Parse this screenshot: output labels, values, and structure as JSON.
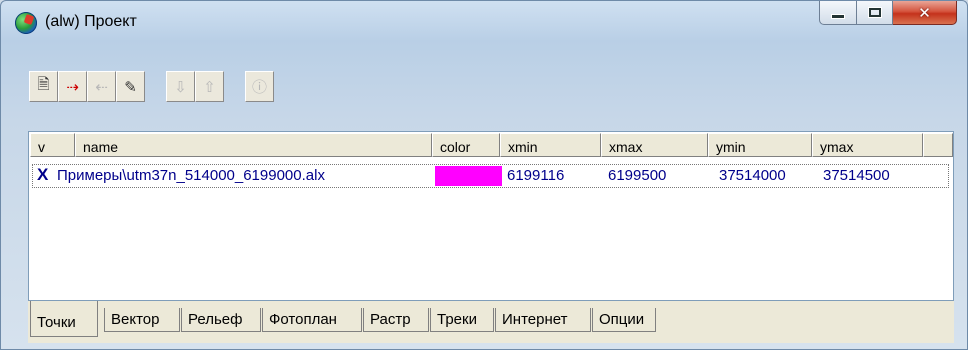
{
  "window": {
    "title": "(alw) Проект"
  },
  "title_buttons": {
    "minimize": "minimize-icon",
    "maximize": "maximize-icon",
    "close": "close-icon"
  },
  "toolbar": {
    "buttons": [
      {
        "icon": "new-document-icon",
        "glyph": "🗎",
        "enabled": true
      },
      {
        "icon": "add-layer-icon",
        "glyph": "⇢",
        "enabled": true
      },
      {
        "icon": "remove-layer-icon",
        "glyph": "⇠",
        "enabled": false
      },
      {
        "icon": "edit-brush-icon",
        "glyph": "🖌",
        "enabled": true
      },
      {
        "icon": "move-down-icon",
        "glyph": "⇩",
        "enabled": false
      },
      {
        "icon": "move-up-icon",
        "glyph": "⇧",
        "enabled": false
      },
      {
        "icon": "info-icon",
        "glyph": "ⓘ",
        "enabled": false
      }
    ]
  },
  "table": {
    "columns": [
      "v",
      "name",
      "color",
      "xmin",
      "xmax",
      "ymin",
      "ymax"
    ],
    "rows": [
      {
        "v": "X",
        "name": "Примеры\\utm37n_514000_6199000.alx",
        "color": "#ff00ff",
        "xmin": "6199116",
        "xmax": "6199500",
        "ymin": "37514000",
        "ymax": "37514500"
      }
    ]
  },
  "tabs": [
    "Точки",
    "Вектор",
    "Рельеф",
    "Фотоплан",
    "Растр",
    "Треки",
    "Интернет",
    "Опции"
  ],
  "active_tab": "Точки"
}
